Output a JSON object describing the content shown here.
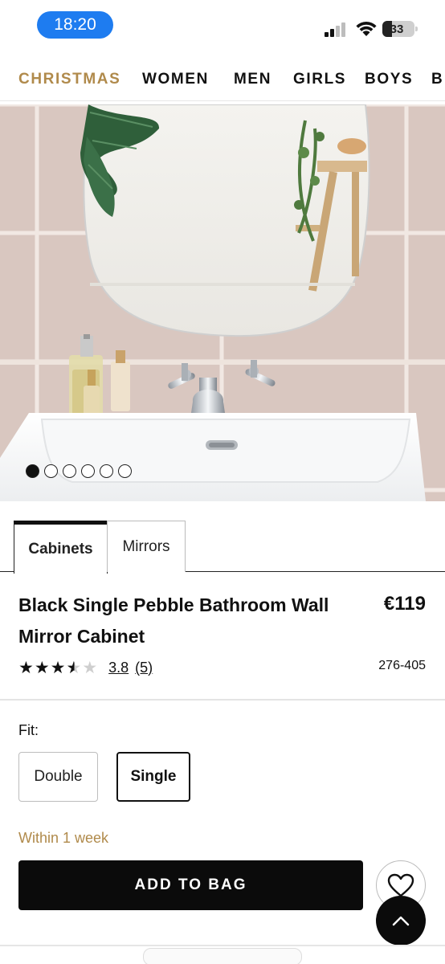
{
  "status_bar": {
    "time": "18:20",
    "battery": "33"
  },
  "nav": {
    "categories": [
      "CHRISTMAS",
      "WOMEN",
      "MEN",
      "GIRLS",
      "BOYS",
      "B"
    ]
  },
  "gallery": {
    "image_count": 6,
    "active_index": 0
  },
  "tabs": [
    {
      "label": "Cabinets",
      "active": true
    },
    {
      "label": "Mirrors",
      "active": false
    }
  ],
  "product": {
    "title": "Black Single Pebble Bathroom Wall Mirror Cabinet",
    "price": "€119",
    "rating_value": "3.8",
    "rating_count": "(5)",
    "rating_stars": 3.8,
    "sku": "276-405"
  },
  "fit": {
    "label": "Fit:",
    "options": [
      {
        "label": "Double",
        "selected": false
      },
      {
        "label": "Single",
        "selected": true
      }
    ]
  },
  "delivery": "Within 1 week",
  "actions": {
    "add_to_bag": "ADD TO BAG"
  },
  "colors": {
    "accent_gold": "#b08a4b",
    "status_pill": "#1e7cf0",
    "primary": "#0b0b0b"
  }
}
